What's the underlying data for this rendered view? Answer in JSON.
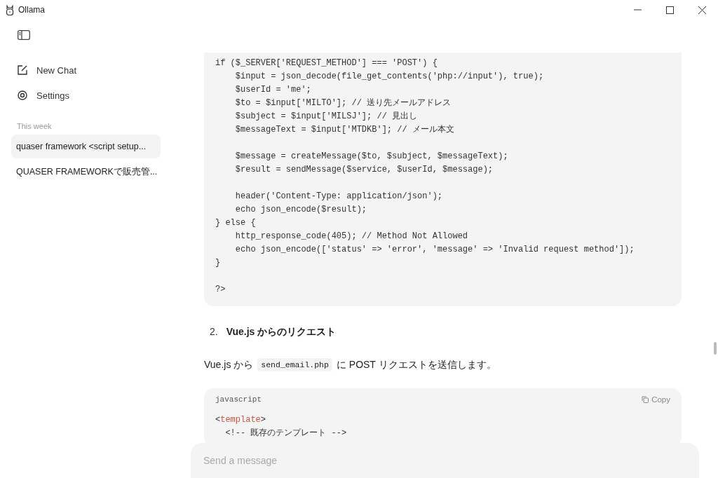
{
  "window": {
    "title": "Ollama",
    "controls": [
      {
        "kind": "minimize"
      },
      {
        "kind": "maximize"
      },
      {
        "kind": "close"
      }
    ]
  },
  "sidebar": {
    "actions": [
      {
        "kind": "new",
        "label": "New Chat"
      },
      {
        "kind": "settings",
        "label": "Settings"
      }
    ],
    "section": "This week",
    "chats": [
      {
        "title": "quaser framework <script setup...",
        "selected": true
      },
      {
        "title": "QUASER FRAMEWORKで販売管...",
        "selected": false
      }
    ]
  },
  "content": {
    "code_block_1": {
      "groups": [
        [
          [
            {
              "text": "if ($_SERVER['REQUEST_METHOD'] === 'POST') {"
            }
          ],
          [
            {
              "text": "    $input = json_decode(file_get_contents('php://input'), true);"
            }
          ],
          [
            {
              "text": "    $userId = 'me';"
            }
          ],
          [
            {
              "text": "    $to = $input['MILTO']; // 送り先メールアドレス"
            }
          ],
          [
            {
              "text": "    $subject = $input['MILSJ']; // 見出し"
            }
          ],
          [
            {
              "text": "    $messageText = $input['MTDKB']; // メール本文"
            }
          ]
        ],
        [
          [
            {
              "text": "    $message = createMessage($to, $subject, $messageText);"
            }
          ],
          [
            {
              "text": "    $result = sendMessage($service, $userId, $message);"
            }
          ]
        ],
        [
          [
            {
              "text": "    header('Content-Type: application/json');"
            }
          ],
          [
            {
              "text": "    echo json_encode($result);"
            }
          ],
          [
            {
              "text": "} else {"
            }
          ],
          [
            {
              "text": "    http_response_code(405); // Method Not Allowed"
            }
          ],
          [
            {
              "text": "    echo json_encode(['status' => 'error', 'message' => 'Invalid request method']);"
            }
          ],
          [
            {
              "text": "}"
            }
          ]
        ],
        [
          [
            {
              "text": "?>"
            }
          ]
        ]
      ]
    },
    "heading": {
      "number": "2.",
      "text": "Vue.js からのリクエスト"
    },
    "paragraph": [
      {
        "kind": "text",
        "text": "Vue.js から"
      },
      {
        "kind": "code",
        "text": "send_email.php"
      },
      {
        "kind": "text",
        "text": "に POST リクエストを送信します。"
      }
    ],
    "code_block_2": {
      "language": "javascript",
      "copy": "Copy",
      "lines": [
        [
          {
            "text": "<"
          },
          {
            "text": "template",
            "kind": "tag"
          },
          {
            "text": ">"
          }
        ],
        [
          {
            "text": "  <!-- 既存のテンプレート -->"
          }
        ]
      ]
    }
  },
  "composer": {
    "placeholder": "Send a message"
  }
}
